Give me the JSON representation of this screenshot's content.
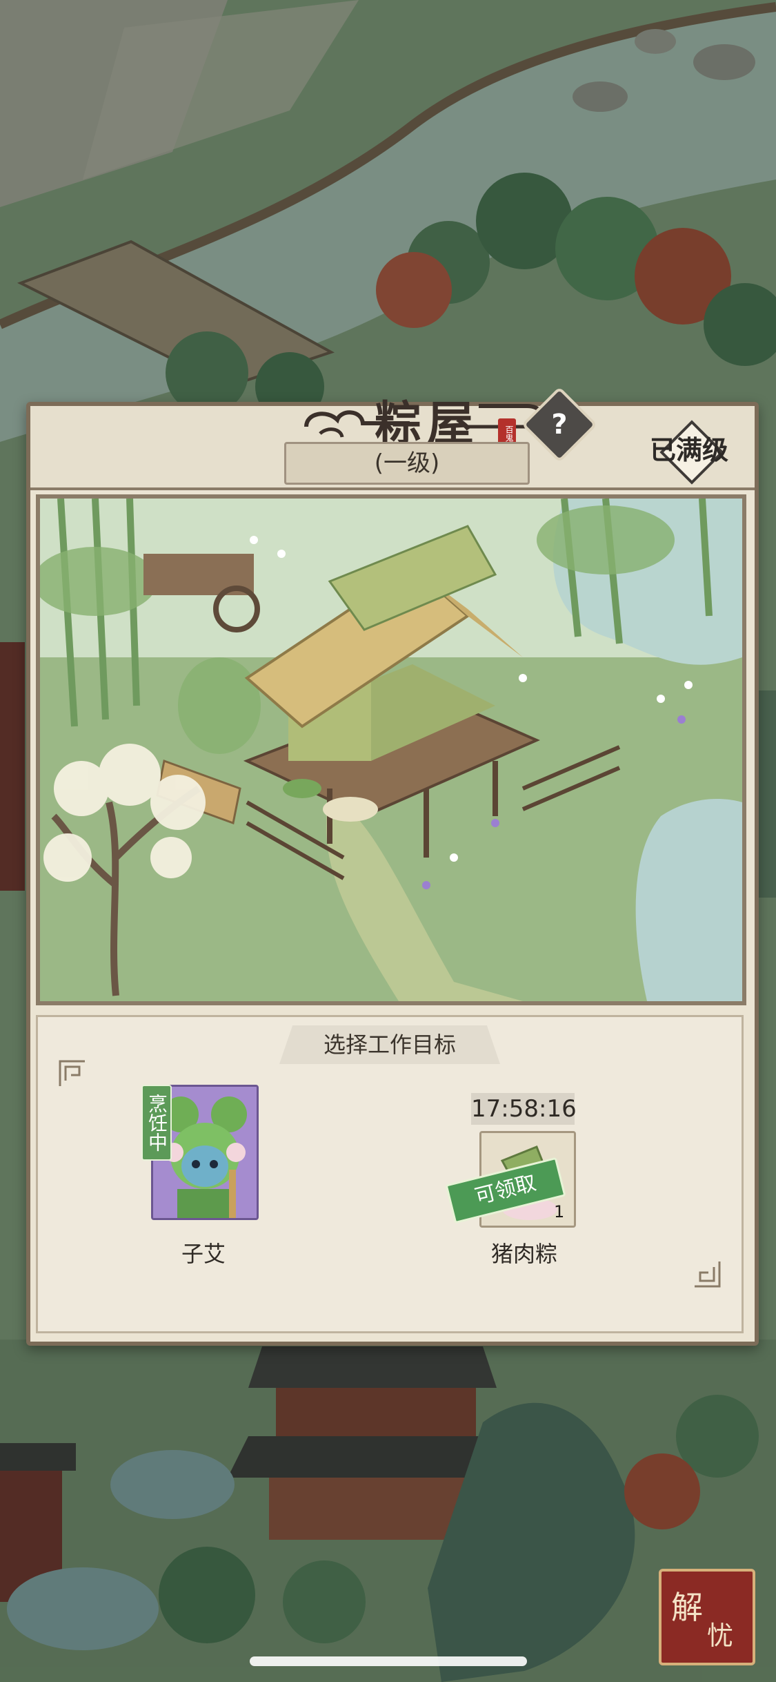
{
  "building": {
    "title": "粽屋",
    "seal_text": "百鬼",
    "level": "(一级)",
    "max_level": "已满级",
    "help_symbol": "?"
  },
  "task": {
    "header": "选择工作目标",
    "worker": {
      "name": "子艾",
      "status": "烹饪中"
    },
    "product": {
      "name": "猪肉粽",
      "timer": "17:58:16",
      "claim_label": "可领取",
      "count": "1"
    }
  },
  "corner_seal": {
    "char1": "解",
    "char2": "忧"
  },
  "colors": {
    "panel_bg": "#ebe4d3",
    "panel_border": "#7c6c58",
    "claim_green": "#4c9a55",
    "seal_red": "#8b2a24"
  }
}
